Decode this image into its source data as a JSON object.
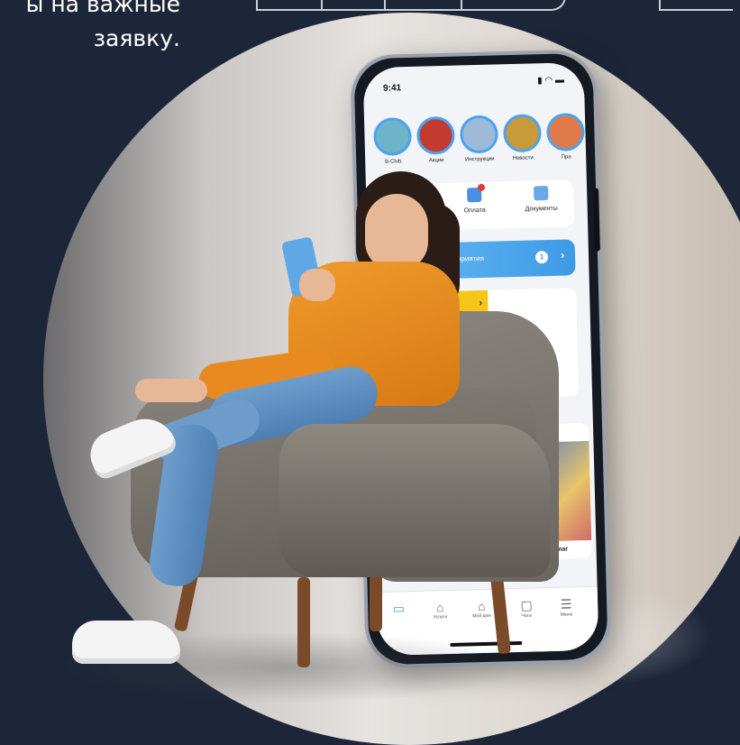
{
  "intro": {
    "line1": "ы на важные",
    "line2": "заявку."
  },
  "phone": {
    "time": "9:41",
    "status_icons": "▮ ◠ ▬",
    "stories": [
      {
        "label": "B-Club"
      },
      {
        "label": "Акции"
      },
      {
        "label": "Инструкции"
      },
      {
        "label": "Новости"
      },
      {
        "label": "Пра"
      }
    ],
    "quick_actions": [
      {
        "label": "Оплата",
        "icon": "payment-card-icon",
        "has_badge": true
      },
      {
        "label": "Документы",
        "icon": "document-icon",
        "has_badge": false
      }
    ],
    "events": {
      "label": "роприятия",
      "count": "1",
      "arrow": "›"
    },
    "banner_arrow": "›",
    "smart_label": "Smar",
    "tabs": [
      {
        "label": "",
        "icon": "home-active-icon"
      },
      {
        "label": "Услуги",
        "icon": "services-icon"
      },
      {
        "label": "Мой дом",
        "icon": "house-icon"
      },
      {
        "label": "Чаты",
        "icon": "chat-icon"
      },
      {
        "label": "Меню",
        "icon": "menu-icon"
      }
    ]
  },
  "colors": {
    "background": "#1d2639",
    "accent_blue": "#4aa3f0",
    "accent_yellow": "#f5c518",
    "sweater_orange": "#f19a2c"
  }
}
